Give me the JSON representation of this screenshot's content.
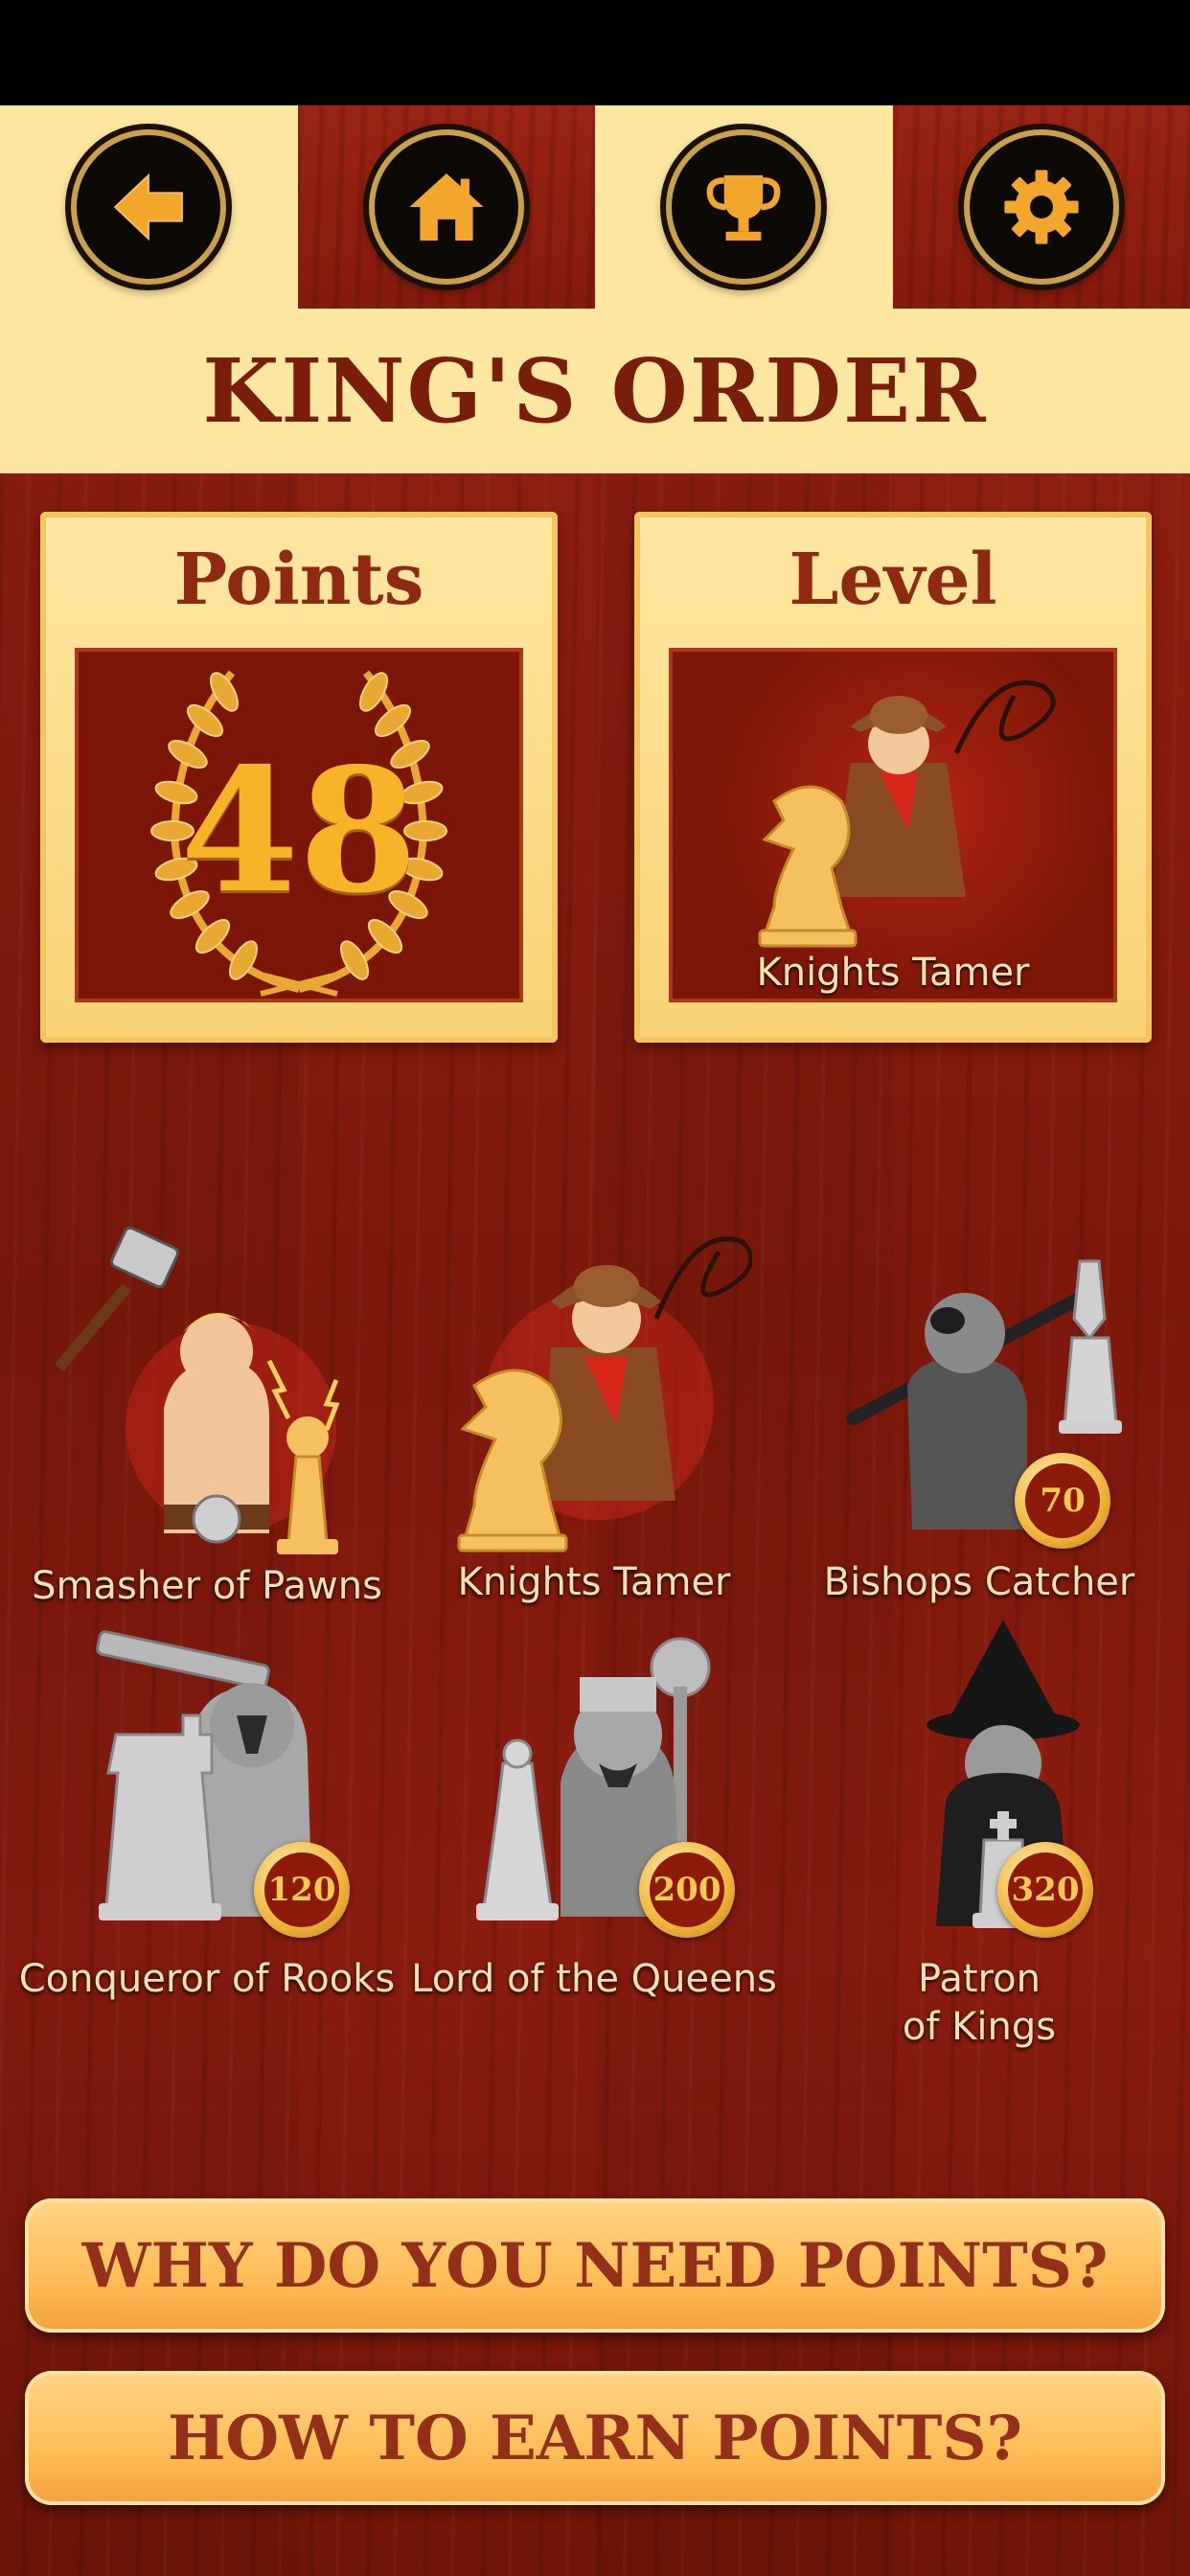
{
  "header": {
    "title": "KING'S ORDER",
    "nav": [
      {
        "name": "back",
        "icon": "arrow-left-icon"
      },
      {
        "name": "home",
        "icon": "home-icon"
      },
      {
        "name": "trophy",
        "icon": "trophy-icon"
      },
      {
        "name": "settings",
        "icon": "gear-icon"
      }
    ]
  },
  "stats": {
    "points": {
      "title": "Points",
      "value": "48"
    },
    "level": {
      "title": "Level",
      "name": "Knights Tamer"
    }
  },
  "achievements": [
    {
      "label": "Smasher of Pawns",
      "unlocked": true
    },
    {
      "label": "Knights Tamer",
      "unlocked": true
    },
    {
      "label": "Bishops Catcher",
      "unlocked": false,
      "cost": "70"
    },
    {
      "label": "Conqueror of Rooks",
      "unlocked": false,
      "cost": "120"
    },
    {
      "label": "Lord of the Queens",
      "unlocked": false,
      "cost": "200"
    },
    {
      "label_line1": "Patron",
      "label_line2": "of Kings",
      "unlocked": false,
      "cost": "320"
    }
  ],
  "buttons": {
    "why": "WHY DO YOU NEED POINTS?",
    "how": "HOW TO EARN POINTS?"
  },
  "colors": {
    "cream": "#fde6a0",
    "title_red": "#7a1e0c",
    "wood": "#8a1a10",
    "gold": "#f8b428"
  }
}
